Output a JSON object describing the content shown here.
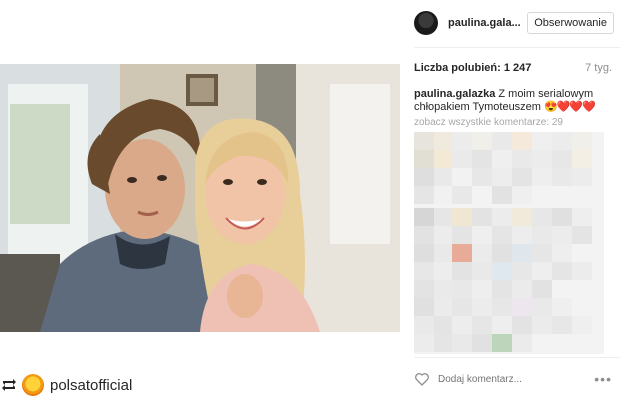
{
  "post": {
    "author": "paulina.gala...",
    "follow_label": "Obserwowanie",
    "likes_label": "Liczba polubień: 1 247",
    "age": "7 tyg.",
    "caption_user": "paulina.galazka",
    "caption_text": "Z moim serialowym chłopakiem Tymoteuszem",
    "caption_emoji": "😍❤️❤️❤️",
    "all_comments": "zobacz wszystkie komentarze: 29",
    "comment_placeholder": "Dodaj komentarz...",
    "more_label": "•••"
  },
  "repost": {
    "username": "polsatofficial"
  },
  "icons": {
    "repost": "repost-icon",
    "heart": "heart-icon",
    "more": "more-options-icon",
    "avatar": "avatar"
  },
  "colors": {
    "hearts": "#e0243a",
    "muted_text": "#8e8e8e",
    "border": "#d8d8d8"
  }
}
